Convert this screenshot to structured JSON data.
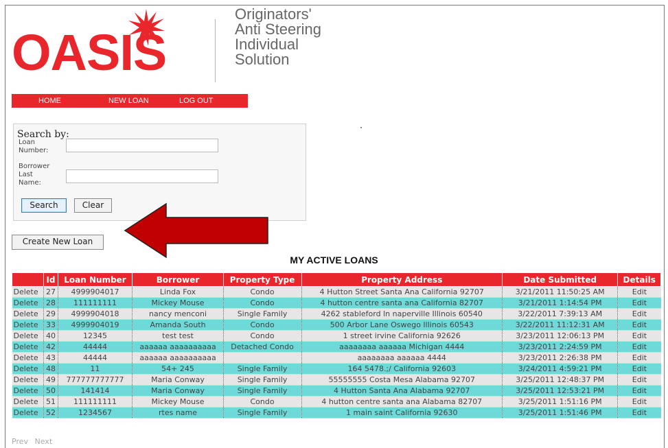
{
  "logo": {
    "text": "OASIS",
    "brand_color": "#e8262b"
  },
  "tagline": [
    "Originators'",
    "Anti Steering",
    "Individual",
    "Solution"
  ],
  "nav": {
    "home": "HOME",
    "new_loan": "NEW LOAN",
    "log_out": "LOG OUT"
  },
  "search": {
    "title": "Search by:",
    "loan_number_label": [
      "Loan",
      "Number:"
    ],
    "loan_number_value": "",
    "borrower_label": [
      "Borrower",
      "Last",
      "Name:"
    ],
    "borrower_value": "",
    "search_button": "Search",
    "clear_button": "Clear"
  },
  "create_button": "Create New Loan",
  "section_title": "MY ACTIVE LOANS",
  "table": {
    "headers": [
      "",
      "Id",
      "Loan Number",
      "Borrower",
      "Property Type",
      "Property Address",
      "Date Submitted",
      "Details"
    ],
    "rows": [
      [
        "Delete",
        "27",
        "4999904017",
        "Linda Fox",
        "Condo",
        "4 Hutton Street Santa Ana California 92707",
        "3/21/2011 11:50:25 AM",
        "Edit"
      ],
      [
        "Delete",
        "28",
        "111111111",
        "Mickey Mouse",
        "Condo",
        "4 hutton centre santa ana California 82707",
        "3/21/2011 1:14:54 PM",
        "Edit"
      ],
      [
        "Delete",
        "29",
        "4999904018",
        "nancy menconi",
        "Single Family",
        "4262 stableford ln naperville Illinois 60540",
        "3/22/2011 7:39:13 AM",
        "Edit"
      ],
      [
        "Delete",
        "33",
        "4999904019",
        "Amanda South",
        "Condo",
        "500 Arbor Lane Oswego Illinois 60543",
        "3/22/2011 11:12:31 AM",
        "Edit"
      ],
      [
        "Delete",
        "40",
        "12345",
        "test test",
        "Condo",
        "1 street irvine California 92626",
        "3/23/2011 12:06:13 PM",
        "Edit"
      ],
      [
        "Delete",
        "42",
        "44444",
        "aaaaaa aaaaaaaaaa",
        "Detached Condo",
        "aaaaaaaa aaaaaa Michigan 4444",
        "3/23/2011 2:24:59 PM",
        "Edit"
      ],
      [
        "Delete",
        "43",
        "44444",
        "aaaaaa aaaaaaaaaa",
        "",
        "aaaaaaaa aaaaaa 4444",
        "3/23/2011 2:26:38 PM",
        "Edit"
      ],
      [
        "Delete",
        "48",
        "11",
        "54+ 245",
        "Single Family",
        "164 5478.;/ California 92603",
        "3/24/2011 4:59:21 PM",
        "Edit"
      ],
      [
        "Delete",
        "49",
        "777777777777",
        "Maria Conway",
        "Single Family",
        "55555555 Costa Mesa Alabama 92707",
        "3/25/2011 12:48:37 PM",
        "Edit"
      ],
      [
        "Delete",
        "50",
        "141414",
        "Maria Conway",
        "Single Family",
        "4 Hutton Santa Ana Alabama 92707",
        "3/25/2011 12:53:21 PM",
        "Edit"
      ],
      [
        "Delete",
        "51",
        "111111111",
        "Mickey Mouse",
        "Condo",
        "4 hutton centre santa ana Alabama 82707",
        "3/25/2011 1:51:16 PM",
        "Edit"
      ],
      [
        "Delete",
        "52",
        "1234567",
        "rtes name",
        "Single Family",
        "1 main saint California 92630",
        "3/25/2011 1:51:46 PM",
        "Edit"
      ]
    ]
  },
  "pager": {
    "prev": "Prev",
    "next": "Next"
  },
  "colors": {
    "header_red": "#e8262b",
    "row_gray": "#e6e6e6",
    "row_cyan": "#6fd8d8",
    "arrow_red": "#c00000"
  }
}
